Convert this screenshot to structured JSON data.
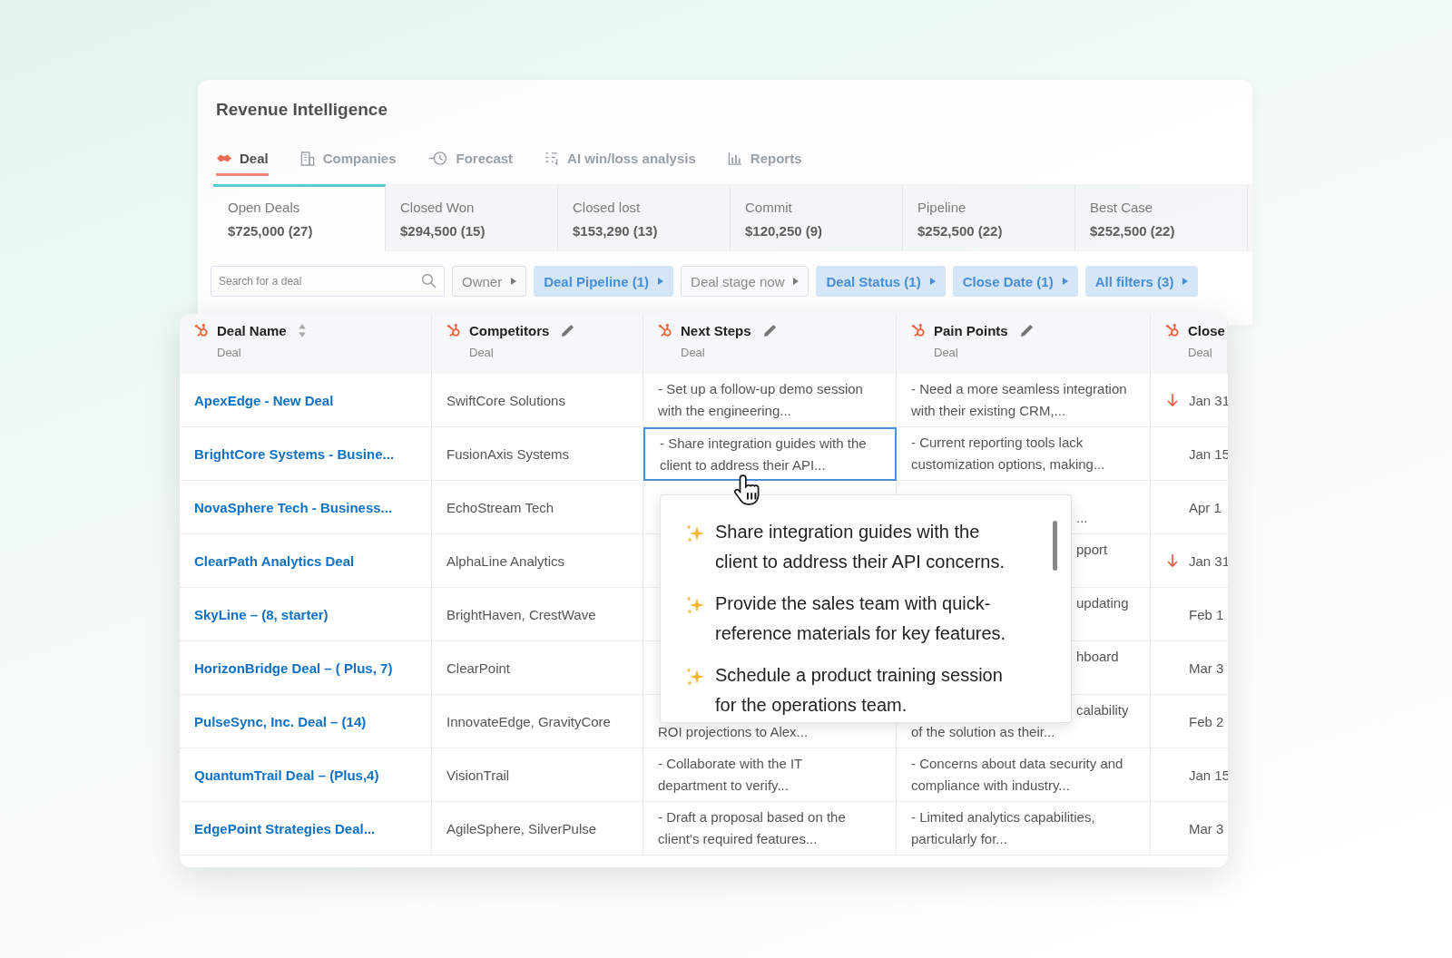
{
  "app": {
    "title": "Revenue Intelligence"
  },
  "tabs": [
    {
      "label": "Deal",
      "kind": "deal",
      "selected": true
    },
    {
      "label": "Companies",
      "kind": "building",
      "selected": false
    },
    {
      "label": "Forecast",
      "kind": "clock",
      "selected": false
    },
    {
      "label": "AI win/loss analysis",
      "kind": "list",
      "selected": false
    },
    {
      "label": "Reports",
      "kind": "chart",
      "selected": false
    }
  ],
  "stats": [
    {
      "label": "Open Deals",
      "value": "$725,000 (27)",
      "selected": true
    },
    {
      "label": "Closed Won",
      "value": "$294,500 (15)",
      "selected": false
    },
    {
      "label": "Closed lost",
      "value": "$153,290 (13)",
      "selected": false
    },
    {
      "label": "Commit",
      "value": "$120,250 (9)",
      "selected": false
    },
    {
      "label": "Pipeline",
      "value": "$252,500 (22)",
      "selected": false
    },
    {
      "label": "Best Case",
      "value": "$252,500 (22)",
      "selected": false
    }
  ],
  "search": {
    "placeholder": "Search for a deal"
  },
  "filters": [
    {
      "label": "Owner",
      "active": false
    },
    {
      "label": "Deal Pipeline (1)",
      "active": true
    },
    {
      "label": "Deal stage now",
      "active": false
    },
    {
      "label": "Deal Status (1)",
      "active": true
    },
    {
      "label": "Close Date (1)",
      "active": true
    },
    {
      "label": "All filters (3)",
      "active": true
    }
  ],
  "table": {
    "columns": [
      {
        "title": "Deal Name",
        "subtitle": "Deal",
        "kind": "sortable"
      },
      {
        "title": "Competitors",
        "subtitle": "Deal",
        "kind": "editable"
      },
      {
        "title": "Next Steps",
        "subtitle": "Deal",
        "kind": "editable"
      },
      {
        "title": "Pain Points",
        "subtitle": "Deal",
        "kind": "editable"
      },
      {
        "title": "Close",
        "subtitle": "Deal",
        "kind": "plain"
      }
    ],
    "rows": [
      {
        "deal_name": "ApexEdge - New Deal",
        "competitors": "SwiftCore Solutions",
        "focused": false,
        "next_steps": {
          "upper": "- Set up a follow-up demo session",
          "lower": "with the engineering..."
        },
        "pain_points": {
          "upper": "- Need a more seamless integration",
          "lower": "with their existing CRM,..."
        },
        "close": {
          "date": "Jan 31",
          "trend_down": true
        }
      },
      {
        "deal_name": "BrightCore Systems - Busine...",
        "competitors": "FusionAxis Systems",
        "focused": true,
        "next_steps": {
          "upper": "- Share integration guides with the",
          "lower": "client to address their API..."
        },
        "pain_points": {
          "upper": "- Current reporting tools lack",
          "lower": "customization options, making..."
        },
        "close": {
          "date": "Jan 15",
          "trend_down": false
        }
      },
      {
        "deal_name": "NovaSphere Tech - Business...",
        "competitors": "EchoStream Tech",
        "focused": false,
        "next_steps": {},
        "pain_points": {
          "lower_tail": "..."
        },
        "close": {
          "date": "Apr 1",
          "trend_down": false
        }
      },
      {
        "deal_name": "ClearPath Analytics Deal",
        "competitors": "AlphaLine Analytics",
        "focused": false,
        "next_steps": {},
        "pain_points": {
          "upper_tail": "pport"
        },
        "close": {
          "date": "Jan 31",
          "trend_down": true
        }
      },
      {
        "deal_name": "SkyLine – (8, starter)",
        "competitors": "BrightHaven, CrestWave",
        "focused": false,
        "next_steps": {},
        "pain_points": {
          "upper_tail": "updating"
        },
        "close": {
          "date": "Feb 1",
          "trend_down": false
        }
      },
      {
        "deal_name": "HorizonBridge Deal – ( Plus, 7)",
        "competitors": "ClearPoint",
        "focused": false,
        "next_steps": {},
        "pain_points": {
          "upper_tail": "hboard"
        },
        "close": {
          "date": "Mar 3",
          "trend_down": false
        }
      },
      {
        "deal_name": "PulseSync, Inc. Deal – (14)",
        "competitors": "InnovateEdge, GravityCore",
        "focused": false,
        "next_steps": {
          "lower": "ROI projections to Alex..."
        },
        "pain_points": {
          "upper_tail": "calability",
          "lower": "of the solution as their..."
        },
        "close": {
          "date": "Feb 2",
          "trend_down": false
        }
      },
      {
        "deal_name": "QuantumTrail Deal – (Plus,4)",
        "competitors": "VisionTrail",
        "focused": false,
        "next_steps": {
          "upper": "- Collaborate with the IT",
          "lower": "department to verify..."
        },
        "pain_points": {
          "upper": "- Concerns about data security and",
          "lower": "compliance with industry..."
        },
        "close": {
          "date": "Jan 15",
          "trend_down": false
        }
      },
      {
        "deal_name": "EdgePoint Strategies Deal...",
        "competitors": "AgileSphere, SilverPulse",
        "focused": false,
        "next_steps": {
          "upper": "- Draft a proposal based on the",
          "lower": "client's required features..."
        },
        "pain_points": {
          "upper": "- Limited analytics capabilities,",
          "lower": "particularly for..."
        },
        "close": {
          "date": "Mar 3",
          "trend_down": false
        }
      }
    ]
  },
  "popover": {
    "items": [
      "Share integration guides with the client to address their API concerns.",
      "Provide the sales team with quick-reference materials for key features.",
      "Schedule a product training session for the operations team."
    ]
  }
}
